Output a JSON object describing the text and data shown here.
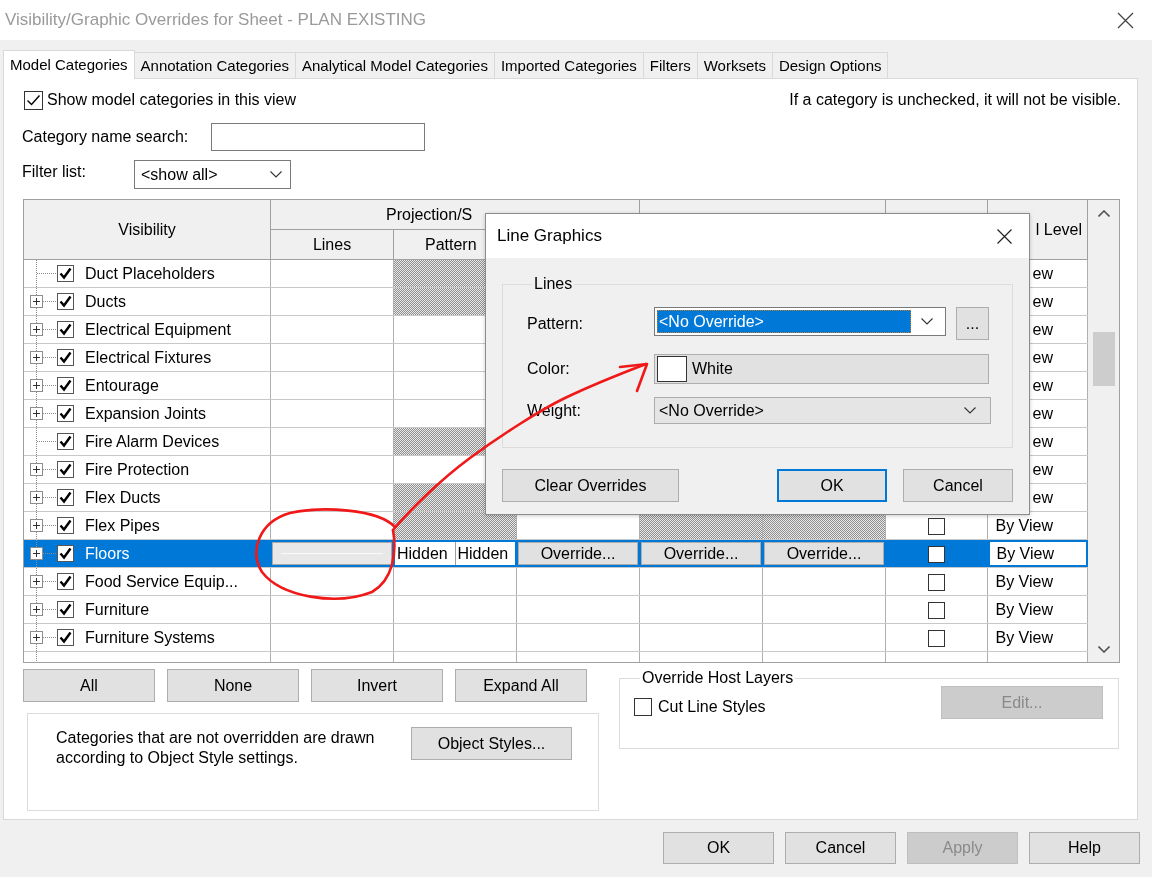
{
  "window": {
    "title": "Visibility/Graphic Overrides for Sheet - PLAN EXISTING"
  },
  "tabs": [
    {
      "label": "Model Categories",
      "selected": true
    },
    {
      "label": "Annotation Categories",
      "selected": false
    },
    {
      "label": "Analytical Model Categories",
      "selected": false
    },
    {
      "label": "Imported Categories",
      "selected": false
    },
    {
      "label": "Filters",
      "selected": false
    },
    {
      "label": "Worksets",
      "selected": false
    },
    {
      "label": "Design Options",
      "selected": false
    }
  ],
  "show_categories": {
    "label": "Show model categories in this view",
    "checked": true
  },
  "hint": "If a category is unchecked, it will not be visible.",
  "search": {
    "label": "Category name search:"
  },
  "filter_list": {
    "label": "Filter list:",
    "value": "<show all>"
  },
  "table": {
    "headers": {
      "visibility": "Visibility",
      "projection_surface": "Projection/S",
      "lines": "Lines",
      "patterns": "Pattern",
      "detail_level": "l Level"
    },
    "rows": [
      {
        "name": "Duct Placeholders",
        "expandable": false,
        "visible": true,
        "selected": false,
        "cells": [
          {
            "kind": "empty"
          },
          {
            "kind": "hatched"
          }
        ],
        "detail_level": "ew"
      },
      {
        "name": "Ducts",
        "expandable": true,
        "visible": true,
        "selected": false,
        "cells": [
          {
            "kind": "empty"
          },
          {
            "kind": "hatched"
          }
        ],
        "detail_level": "ew"
      },
      {
        "name": "Electrical Equipment",
        "expandable": true,
        "visible": true,
        "selected": false,
        "cells": [
          {
            "kind": "empty"
          },
          {
            "kind": "empty"
          }
        ],
        "detail_level": "ew"
      },
      {
        "name": "Electrical Fixtures",
        "expandable": true,
        "visible": true,
        "selected": false,
        "cells": [
          {
            "kind": "empty"
          },
          {
            "kind": "empty"
          }
        ],
        "detail_level": "ew"
      },
      {
        "name": "Entourage",
        "expandable": true,
        "visible": true,
        "selected": false,
        "cells": [
          {
            "kind": "empty"
          },
          {
            "kind": "empty"
          }
        ],
        "detail_level": "ew"
      },
      {
        "name": "Expansion Joints",
        "expandable": true,
        "visible": true,
        "selected": false,
        "cells": [
          {
            "kind": "empty"
          },
          {
            "kind": "empty"
          }
        ],
        "detail_level": "ew"
      },
      {
        "name": "Fire Alarm Devices",
        "expandable": false,
        "visible": true,
        "selected": false,
        "cells": [
          {
            "kind": "empty"
          },
          {
            "kind": "hatched"
          }
        ],
        "detail_level": "ew"
      },
      {
        "name": "Fire Protection",
        "expandable": true,
        "visible": true,
        "selected": false,
        "cells": [
          {
            "kind": "empty"
          },
          {
            "kind": "empty"
          }
        ],
        "detail_level": "ew"
      },
      {
        "name": "Flex Ducts",
        "expandable": true,
        "visible": true,
        "selected": false,
        "cells": [
          {
            "kind": "empty"
          },
          {
            "kind": "hatched"
          }
        ],
        "detail_level": "ew"
      },
      {
        "name": "Flex Pipes",
        "expandable": true,
        "visible": true,
        "selected": false,
        "cells": [
          {
            "kind": "empty"
          },
          {
            "kind": "hatched"
          },
          {
            "kind": "empty"
          },
          {
            "kind": "hatched"
          },
          {
            "kind": "hatched"
          }
        ],
        "halftone": false,
        "detail_level": "By View"
      },
      {
        "name": "Floors",
        "expandable": true,
        "visible": true,
        "selected": true,
        "cells": [
          {
            "kind": "line-sample"
          },
          {
            "kind": "split-text",
            "texts": [
              "Hidden",
              "Hidden"
            ]
          },
          {
            "kind": "button",
            "text": "Override..."
          },
          {
            "kind": "button",
            "text": "Override..."
          },
          {
            "kind": "button",
            "text": "Override..."
          }
        ],
        "halftone": false,
        "detail_level": "By View"
      },
      {
        "name": "Food Service Equip...",
        "expandable": true,
        "visible": true,
        "selected": false,
        "cells": [
          {
            "kind": "empty"
          },
          {
            "kind": "empty"
          },
          {
            "kind": "empty"
          },
          {
            "kind": "empty"
          },
          {
            "kind": "empty"
          }
        ],
        "halftone": false,
        "detail_level": "By View"
      },
      {
        "name": "Furniture",
        "expandable": true,
        "visible": true,
        "selected": false,
        "cells": [
          {
            "kind": "empty"
          },
          {
            "kind": "empty"
          },
          {
            "kind": "empty"
          },
          {
            "kind": "empty"
          },
          {
            "kind": "empty"
          }
        ],
        "halftone": false,
        "detail_level": "By View"
      },
      {
        "name": "Furniture Systems",
        "expandable": true,
        "visible": true,
        "selected": false,
        "cells": [
          {
            "kind": "empty"
          },
          {
            "kind": "empty"
          },
          {
            "kind": "empty"
          },
          {
            "kind": "empty"
          },
          {
            "kind": "empty"
          }
        ],
        "halftone": false,
        "detail_level": "By View"
      }
    ]
  },
  "tree_buttons": [
    "All",
    "None",
    "Invert",
    "Expand All"
  ],
  "note": {
    "text": "Categories that are not overridden are drawn according to Object Style settings.",
    "button": "Object Styles..."
  },
  "host_layers": {
    "title": "Override Host Layers",
    "checkbox": {
      "label": "Cut Line Styles",
      "checked": false
    },
    "edit_button": {
      "label": "Edit...",
      "disabled": true
    }
  },
  "footer_buttons": [
    {
      "label": "OK",
      "disabled": false
    },
    {
      "label": "Cancel",
      "disabled": false
    },
    {
      "label": "Apply",
      "disabled": true
    },
    {
      "label": "Help",
      "disabled": false
    }
  ],
  "line_graphics_dialog": {
    "title": "Line Graphics",
    "group": "Lines",
    "fields": [
      {
        "kind": "combo",
        "label": "Pattern:",
        "value": "<No Override>",
        "focused": true,
        "button": "..."
      },
      {
        "kind": "color",
        "label": "Color:",
        "value": "White",
        "color": "#ffffff"
      },
      {
        "kind": "dropdown",
        "label": "Weight:",
        "value": "<No Override>",
        "focused": false
      }
    ],
    "buttons": [
      {
        "label": "Clear Overrides",
        "default": false
      },
      {
        "label": "OK",
        "default": true
      },
      {
        "label": "Cancel",
        "default": false
      }
    ]
  }
}
